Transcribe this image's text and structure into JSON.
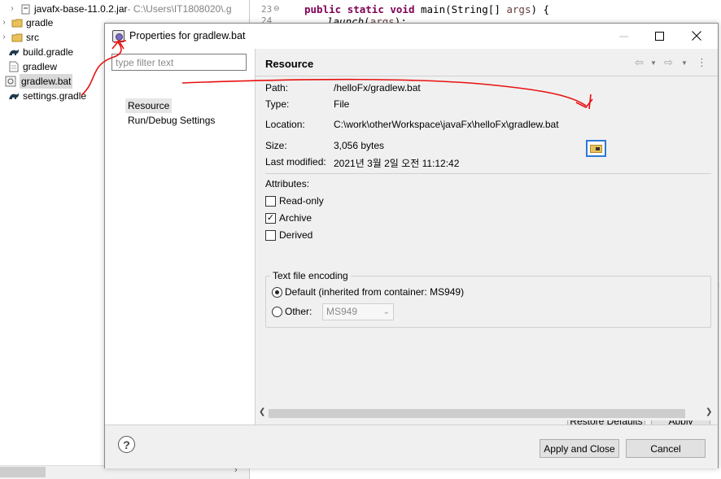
{
  "explorer": {
    "items": [
      {
        "label": "javafx-base-11.0.2.jar",
        "suffix": " - C:\\Users\\IT1808020\\.g",
        "icon": "jar-icon"
      },
      {
        "label": "gradle",
        "icon": "folder-icon"
      },
      {
        "label": "src",
        "icon": "folder-icon"
      },
      {
        "label": "build.gradle",
        "icon": "gradle-icon"
      },
      {
        "label": "gradlew",
        "icon": "file-icon"
      },
      {
        "label": "gradlew.bat",
        "icon": "bat-file-icon",
        "selected": true
      },
      {
        "label": "settings.gradle",
        "icon": "gradle-icon"
      }
    ]
  },
  "editor": {
    "line_numbers": [
      "23",
      "24"
    ],
    "lines": [
      {
        "kw1": "public",
        "kw2": "static",
        "kw3": "void",
        "rest": " main(String[] ",
        "param": "args",
        "end": ") {"
      },
      {
        "call": "launch",
        "arg": "args",
        "end": ");"
      }
    ]
  },
  "dialog": {
    "title": "Properties for gradlew.bat",
    "filter_placeholder": "type filter text",
    "nav": [
      "Resource",
      "Run/Debug Settings"
    ],
    "page_title": "Resource",
    "fields": {
      "path_label": "Path:",
      "path_value": "/helloFx/gradlew.bat",
      "type_label": "Type:",
      "type_value": "File",
      "location_label": "Location:",
      "location_value": "C:\\work\\otherWorkspace\\javaFx\\helloFx\\gradlew.bat",
      "size_label": "Size:",
      "size_value": "3,056  bytes",
      "modified_label": "Last modified:",
      "modified_value": "2021년 3월 2일 오전 11:12:42"
    },
    "attributes": {
      "label": "Attributes:",
      "read_only": "Read-only",
      "read_only_checked": false,
      "archive": "Archive",
      "archive_checked": true,
      "derived": "Derived",
      "derived_checked": false
    },
    "encoding": {
      "legend": "Text file encoding",
      "default_label": "Default (inherited from container: MS949)",
      "other_label": "Other:",
      "other_value": "MS949",
      "selected": "default"
    },
    "buttons": {
      "restore": "Restore Defaults",
      "apply": "Apply",
      "apply_close": "Apply and Close",
      "cancel": "Cancel"
    },
    "icons": {
      "back": "back-arrow-icon",
      "forward": "forward-arrow-icon",
      "menu": "view-menu-icon",
      "help": "help-icon",
      "location": "open-folder-icon"
    }
  },
  "colors": {
    "annotation": "#e81010",
    "keyword": "#7f0055",
    "focus": "#2b7ad6"
  }
}
